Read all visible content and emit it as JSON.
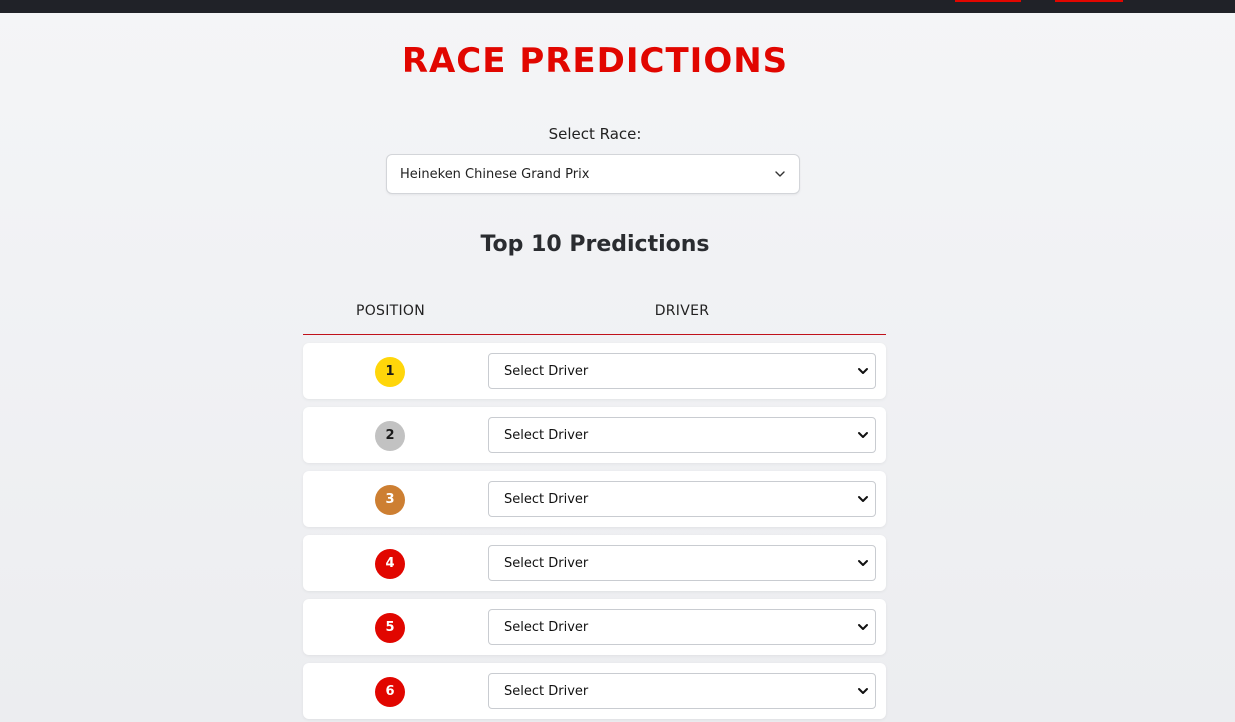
{
  "page": {
    "title": "RACE PREDICTIONS",
    "race_label": "Select Race:",
    "selected_race": "Heineken Chinese Grand Prix",
    "subtitle": "Top 10 Predictions"
  },
  "table": {
    "headers": {
      "position": "POSITION",
      "driver": "DRIVER"
    },
    "rows": [
      {
        "position": "1",
        "driver": "Select Driver",
        "badge_color": "#ffd60a",
        "badge_text_color": "#1a1a1a"
      },
      {
        "position": "2",
        "driver": "Select Driver",
        "badge_color": "#c2c2c2",
        "badge_text_color": "#1a1a1a"
      },
      {
        "position": "3",
        "driver": "Select Driver",
        "badge_color": "#cd7f32",
        "badge_text_color": "#ffffff"
      },
      {
        "position": "4",
        "driver": "Select Driver",
        "badge_color": "#e10600",
        "badge_text_color": "#ffffff"
      },
      {
        "position": "5",
        "driver": "Select Driver",
        "badge_color": "#e10600",
        "badge_text_color": "#ffffff"
      },
      {
        "position": "6",
        "driver": "Select Driver",
        "badge_color": "#e10600",
        "badge_text_color": "#ffffff"
      }
    ]
  },
  "colors": {
    "accent": "#e10600",
    "topbar": "#202228",
    "background": "#f3f4f6"
  },
  "icons": {
    "select_chevron": "chevron-down-icon"
  }
}
